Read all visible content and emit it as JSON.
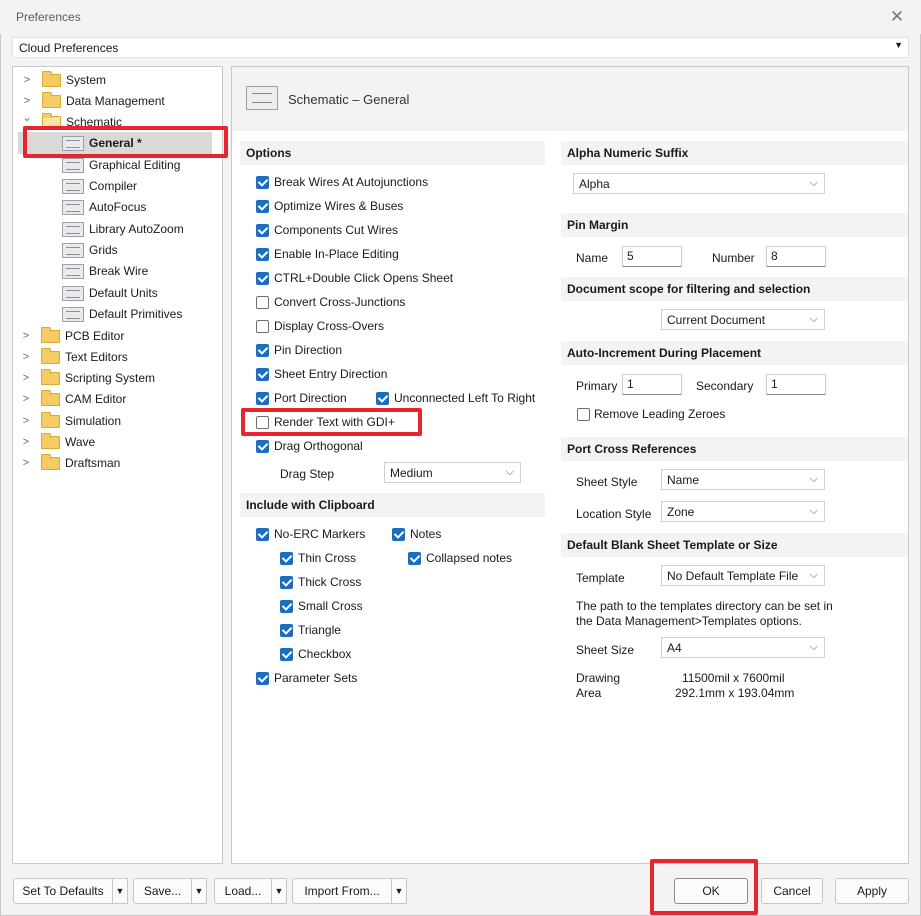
{
  "window": {
    "title": "Preferences",
    "close": "✕"
  },
  "cloud": {
    "label": "Cloud Preferences",
    "arrow": "▼"
  },
  "tree": {
    "top": [
      {
        "label": "System",
        "chev": ">"
      },
      {
        "label": "Data Management",
        "chev": ">"
      },
      {
        "label": "Schematic",
        "chev": "⌄"
      }
    ],
    "schematic_children": [
      "General *",
      "Graphical Editing",
      "Compiler",
      "AutoFocus",
      "Library AutoZoom",
      "Grids",
      "Break Wire",
      "Default Units",
      "Default Primitives"
    ],
    "bottom": [
      {
        "label": "PCB Editor",
        "chev": ">"
      },
      {
        "label": "Text Editors",
        "chev": ">"
      },
      {
        "label": "Scripting System",
        "chev": ">"
      },
      {
        "label": "CAM Editor",
        "chev": ">"
      },
      {
        "label": "Simulation",
        "chev": ">"
      },
      {
        "label": "Wave",
        "chev": ">"
      },
      {
        "label": "Draftsman",
        "chev": ">"
      }
    ]
  },
  "header": {
    "title": "Schematic – General"
  },
  "options": {
    "title": "Options",
    "items": [
      {
        "label": "Break Wires At Autojunctions",
        "checked": true
      },
      {
        "label": "Optimize Wires & Buses",
        "checked": true
      },
      {
        "label": "Components Cut Wires",
        "checked": true
      },
      {
        "label": "Enable In-Place Editing",
        "checked": true
      },
      {
        "label": "CTRL+Double Click Opens Sheet",
        "checked": true
      },
      {
        "label": "Convert Cross-Junctions",
        "checked": false
      },
      {
        "label": "Display Cross-Overs",
        "checked": false
      },
      {
        "label": "Pin Direction",
        "checked": true
      },
      {
        "label": "Sheet Entry Direction",
        "checked": true
      },
      {
        "label": "Port Direction",
        "checked": true
      },
      {
        "label": "Render Text with GDI+",
        "checked": false
      },
      {
        "label": "Drag Orthogonal",
        "checked": true
      }
    ],
    "unconnected": {
      "label": "Unconnected Left To Right",
      "checked": true
    },
    "drag_step_label": "Drag Step",
    "drag_step_value": "Medium"
  },
  "clipboard": {
    "title": "Include with Clipboard",
    "no_erc": "No-ERC Markers",
    "notes": "Notes",
    "thin": "Thin Cross",
    "collapsed": "Collapsed notes",
    "thick": "Thick Cross",
    "small": "Small Cross",
    "triangle": "Triangle",
    "checkbox": "Checkbox",
    "params": "Parameter Sets"
  },
  "alpha": {
    "title": "Alpha Numeric Suffix",
    "value": "Alpha"
  },
  "pin_margin": {
    "title": "Pin Margin",
    "name_label": "Name",
    "name_value": "5",
    "number_label": "Number",
    "number_value": "8"
  },
  "doc_scope": {
    "title": "Document scope for filtering and selection",
    "value": "Current Document"
  },
  "auto_inc": {
    "title": "Auto-Increment During Placement",
    "primary_label": "Primary",
    "primary_value": "1",
    "secondary_label": "Secondary",
    "secondary_value": "1",
    "remove_zeroes": "Remove Leading Zeroes"
  },
  "port_cross": {
    "title": "Port Cross References",
    "sheet_style_label": "Sheet Style",
    "sheet_style_value": "Name",
    "location_style_label": "Location Style",
    "location_style_value": "Zone"
  },
  "template": {
    "title": "Default Blank Sheet Template or Size",
    "template_label": "Template",
    "template_value": "No Default Template File",
    "note_line1": "The path to the templates directory can be set in",
    "note_line2": "the Data Management>Templates options.",
    "sheet_size_label": "Sheet Size",
    "sheet_size_value": "A4",
    "drawing_label": "Drawing",
    "area_label": "Area",
    "drawing_mil": "11500mil x 7600mil",
    "drawing_mm": "292.1mm x 193.04mm"
  },
  "buttons": {
    "defaults": "Set To Defaults",
    "save": "Save...",
    "load": "Load...",
    "import": "Import From...",
    "ok": "OK",
    "cancel": "Cancel",
    "apply": "Apply",
    "arrow": "▼",
    "chev": "⌵"
  },
  "colors": {
    "accent": "#1b6dc1",
    "highlight": "#e8252f"
  }
}
